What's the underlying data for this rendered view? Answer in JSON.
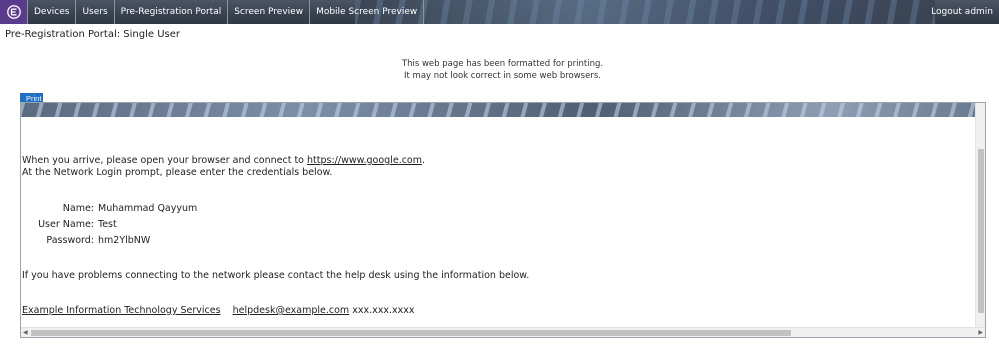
{
  "nav": {
    "items": [
      {
        "label": "Devices"
      },
      {
        "label": "Users"
      },
      {
        "label": "Pre-Registration Portal"
      },
      {
        "label": "Screen Preview"
      },
      {
        "label": "Mobile Screen Preview"
      }
    ],
    "logout_label": "Logout admin",
    "brand_color": "#5b3b8c",
    "logo_icon": "extreme-logo-icon"
  },
  "page": {
    "title": "Pre-Registration Portal: Single User",
    "print_note_line1": "This web page has been formatted for printing.",
    "print_note_line2": "It may not look correct in some web browsers.",
    "print_button": "Print"
  },
  "content": {
    "arrive_prefix": "When you arrive, please open your browser and connect to ",
    "arrive_link": "https://www.google.com",
    "arrive_suffix": ".",
    "prompt_line": "At the Network Login prompt, please enter the credentials below.",
    "credentials": [
      {
        "label": "Name:",
        "value": "Muhammad Qayyum"
      },
      {
        "label": "User Name:",
        "value": "Test"
      },
      {
        "label": "Password:",
        "value": "hm2YlbNW"
      }
    ],
    "help_line": "If you have problems connecting to the network please contact the help desk using the information below.",
    "org_link": "Example Information Technology Services",
    "email_link": "helpdesk@example.com",
    "phone": "xxx.xxx.xxxx"
  }
}
